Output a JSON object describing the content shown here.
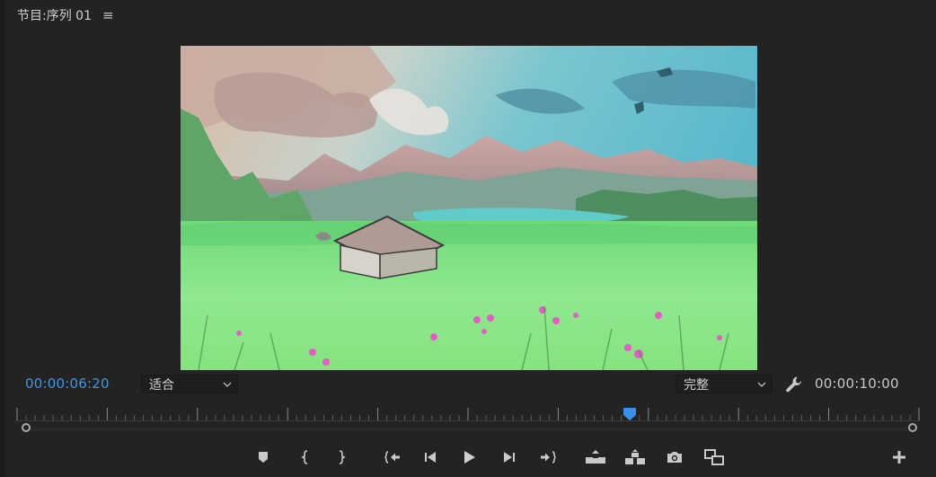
{
  "panel": {
    "title": "节目:序列 01",
    "menu_icon": "≡"
  },
  "timecodes": {
    "current": "00:00:06:20",
    "duration": "00:00:10:00"
  },
  "zoom_select": {
    "value": "适合"
  },
  "quality_select": {
    "value": "完整"
  },
  "colors": {
    "accent": "#3c97e8",
    "background": "#232323",
    "icon": "#c9c9c9"
  },
  "playhead": {
    "position_fraction": 0.68
  },
  "transport": {
    "buttons": [
      {
        "name": "add-marker-button",
        "icon": "marker-icon"
      },
      {
        "name": "mark-in-button",
        "icon": "mark-in-icon"
      },
      {
        "name": "mark-out-button",
        "icon": "mark-out-icon"
      },
      {
        "name": "go-to-in-button",
        "icon": "go-to-in-icon"
      },
      {
        "name": "step-back-button",
        "icon": "step-back-icon"
      },
      {
        "name": "play-button",
        "icon": "play-icon"
      },
      {
        "name": "step-forward-button",
        "icon": "step-forward-icon"
      },
      {
        "name": "go-to-out-button",
        "icon": "go-to-out-icon"
      },
      {
        "name": "lift-button",
        "icon": "lift-icon"
      },
      {
        "name": "extract-button",
        "icon": "extract-icon"
      },
      {
        "name": "export-frame-button",
        "icon": "camera-icon"
      },
      {
        "name": "comparison-view-button",
        "icon": "comparison-view-icon"
      },
      {
        "name": "button-editor-button",
        "icon": "plus-icon"
      }
    ]
  }
}
